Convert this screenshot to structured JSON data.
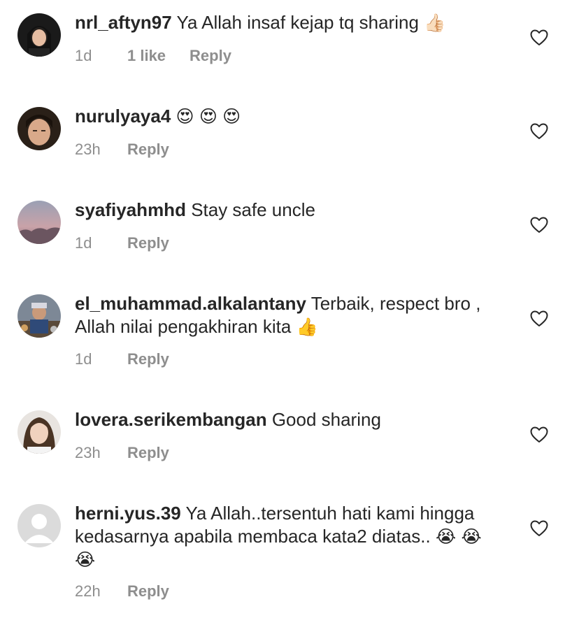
{
  "comments": [
    {
      "username": "nrl_aftyn97",
      "text": "Ya Allah insaf kejap tq sharing",
      "emojis": [
        "👍🏻"
      ],
      "time": "1d",
      "likes": "1 like",
      "reply": "Reply"
    },
    {
      "username": "nurulyaya4",
      "text": "",
      "emojis": [
        "😍",
        "😍",
        "😍"
      ],
      "time": "23h",
      "likes": "",
      "reply": "Reply"
    },
    {
      "username": "syafiyahmhd",
      "text": "Stay safe uncle",
      "emojis": [],
      "time": "1d",
      "likes": "",
      "reply": "Reply"
    },
    {
      "username": "el_muhammad.alkalantany",
      "text": "Terbaik, respect bro , Allah nilai pengakhiran kita",
      "emojis": [
        "👍"
      ],
      "time": "1d",
      "likes": "",
      "reply": "Reply"
    },
    {
      "username": "lovera.serikembangan",
      "text": "Good sharing",
      "emojis": [],
      "time": "23h",
      "likes": "",
      "reply": "Reply"
    },
    {
      "username": "herni.yus.39",
      "text": "Ya Allah..tersentuh hati kami hingga kedasarnya apabila membaca kata2 diatas..",
      "emojis": [
        "😭",
        "😭",
        "😭"
      ],
      "time": "22h",
      "likes": "",
      "reply": "Reply"
    }
  ],
  "icons": {
    "like": "heart-outline-icon",
    "default_avatar": "default-avatar-icon"
  },
  "colors": {
    "text": "#262626",
    "meta": "#8e8e8e",
    "background": "#ffffff"
  }
}
